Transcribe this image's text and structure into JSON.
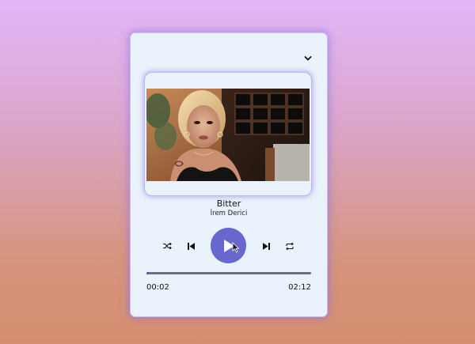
{
  "player": {
    "title": "Bitter",
    "artist": "İrem Derici",
    "current_time": "00:02",
    "total_time": "02:12",
    "progress_fraction": 0.015,
    "colors": {
      "accent": "#6866cf",
      "card": "#eaf3fb",
      "progress_track": "#6f6f7a",
      "progress_fill": "#4f4fd6"
    }
  },
  "icons": {
    "collapse": "chevron-down-icon",
    "cover": "album-cover",
    "shuffle": "shuffle-icon",
    "previous": "skip-previous-icon",
    "play": "play-icon",
    "next": "skip-next-icon",
    "repeat": "repeat-icon",
    "cursor": "mouse-cursor-icon"
  }
}
